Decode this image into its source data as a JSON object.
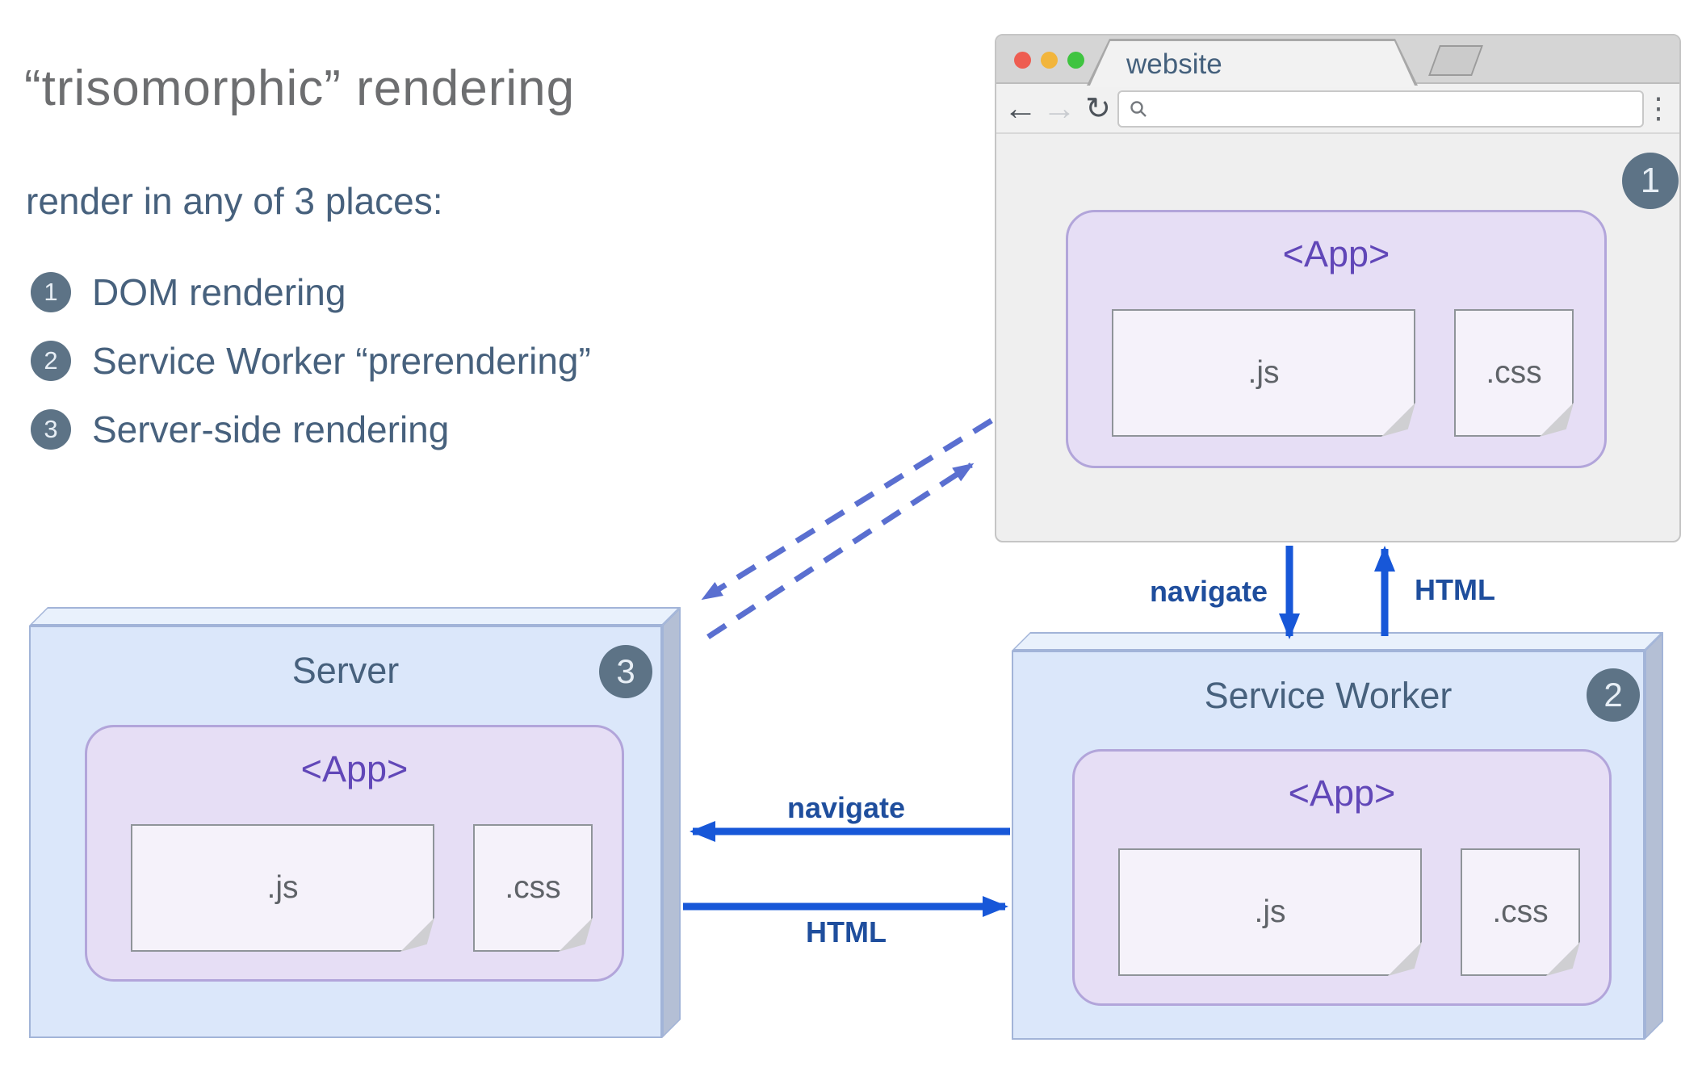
{
  "intro": {
    "title": "“trisomorphic” rendering",
    "subtitle": "render in any of 3 places:",
    "items": [
      {
        "number": "1",
        "label": "DOM rendering"
      },
      {
        "number": "2",
        "label": "Service Worker “prerendering”"
      },
      {
        "number": "3",
        "label": "Server-side rendering"
      }
    ]
  },
  "browser": {
    "tab_title": "website",
    "url_value": "",
    "badge": "1",
    "app_label": "<App>",
    "js_label": ".js",
    "css_label": ".css"
  },
  "server": {
    "title": "Server",
    "badge": "3",
    "app_label": "<App>",
    "js_label": ".js",
    "css_label": ".css"
  },
  "service_worker": {
    "title": "Service Worker",
    "badge": "2",
    "app_label": "<App>",
    "js_label": ".js",
    "css_label": ".css"
  },
  "arrows": {
    "browser_to_sw": "navigate",
    "sw_to_browser": "HTML",
    "sw_to_server": "navigate",
    "server_to_sw": "HTML"
  },
  "colors": {
    "solid_arrow_blue": "#1757d8",
    "dashed_arrow_periwinkle": "#5a6fd0",
    "arrow_label_navy": "#1f4e9d",
    "badge_slate": "#5d7386",
    "text_slate": "#47617d",
    "title_gray": "#6d6e70",
    "app_purple_text": "#6147b8",
    "app_fill": "#e6def5",
    "box_front_blue": "#dbe7fa"
  }
}
